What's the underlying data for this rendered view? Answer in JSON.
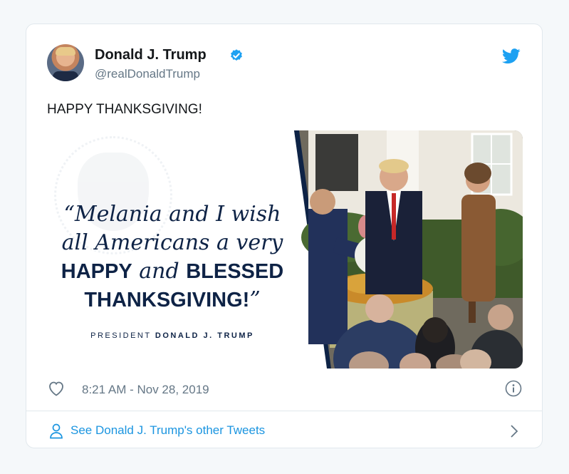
{
  "tweet": {
    "author_name": "Donald J. Trump",
    "handle": "@realDonaldTrump",
    "text": "HAPPY THANKSGIVING!",
    "timestamp": "8:21 AM - Nov 28, 2019"
  },
  "media": {
    "quote_line1": "“Melania and I wish",
    "quote_line2": "all  Americans a very",
    "quote_line3_caps1": "HAPPY",
    "quote_line3_mid": " and ",
    "quote_line3_caps2": "BLESSED",
    "quote_line4": "THANKSGIVING!",
    "quote_close": "”",
    "attribution_prefix": "PRESIDENT ",
    "attribution_name": "DONALD J. TRUMP"
  },
  "footer": {
    "see_other": "See Donald J. Trump's other Tweets"
  },
  "colors": {
    "twitter_blue": "#1da1f2",
    "link_blue": "#1b95e0",
    "navy": "#0e2346"
  },
  "icons": [
    "avatar",
    "verified-badge-icon",
    "twitter-bird-icon",
    "heart-icon",
    "info-icon",
    "person-icon",
    "chevron-right-icon"
  ]
}
